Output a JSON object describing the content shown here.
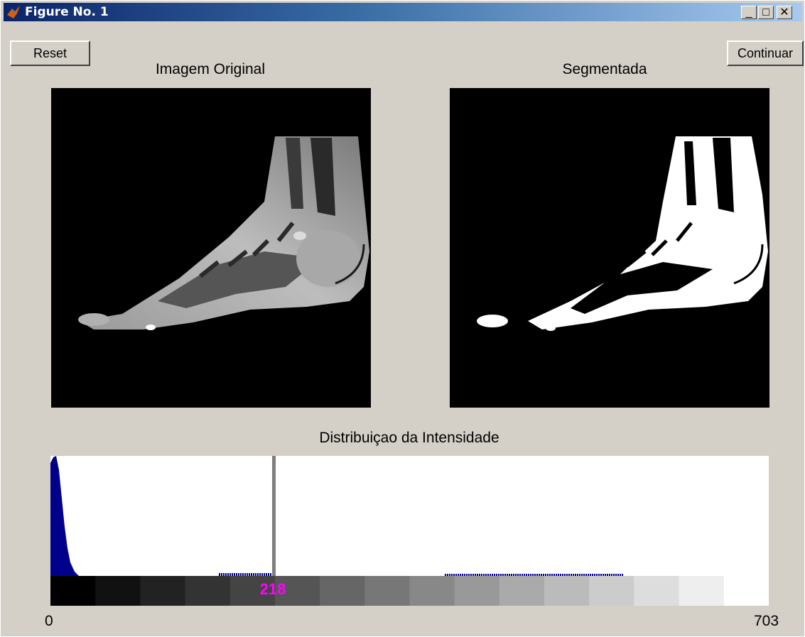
{
  "window": {
    "title": "Figure No. 1",
    "buttons": {
      "minimize": "_",
      "maximize": "□",
      "close": "✕"
    }
  },
  "toolbar": {
    "reset_label": "Reset",
    "continue_label": "Continuar"
  },
  "panels": {
    "original_title": "Imagem Original",
    "segmented_title": "Segmentada"
  },
  "histogram": {
    "title": "Distribuiçao da Intensidade",
    "x_min_label": "0",
    "x_max_label": "703",
    "threshold_value": "218",
    "threshold_color": "#ff00ff",
    "bar_color": "#00008b",
    "x_min": 0,
    "x_max": 703,
    "threshold": 218,
    "colorbar_steps": 16
  }
}
